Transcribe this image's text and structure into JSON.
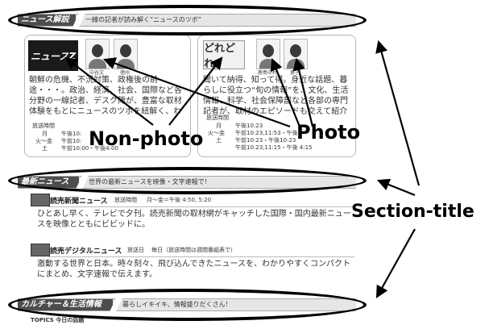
{
  "sections": {
    "news_kaisetsu": {
      "title": "ニュース解説",
      "subtitle": "一線の記者が読み解く“ニュースのツボ”"
    },
    "saishin_news": {
      "title": "最新ニュース",
      "subtitle": "世界の最新ニュースを映像・文字速報で！"
    },
    "culture": {
      "title": "カルチャー＆生活情報",
      "subtitle": "暮らしイキイキ、情報盛りだくさん！"
    }
  },
  "left_panel": {
    "logo_text": "ニュースZ",
    "person1_caption": "中谷文",
    "person2_caption": "徳州",
    "body": "朝鮮の危機、不況対策、政権後の前途・・・。政治、経済、社会、国際など各分野の一線記者、デスク陣が、豊富な取材体験をもとにニュースのツボを紐解く、わかりやすく解説します。",
    "schedule_label": "放送時間",
    "schedule": [
      {
        "day": "月",
        "time": "午後10:"
      },
      {
        "day": "火～金",
        "time": "午前10:"
      },
      {
        "day": "土",
        "time": "午前10:00・午後4:00"
      }
    ]
  },
  "right_panel": {
    "logo_text": "どれどれ",
    "person1_caption": "鹿島中村",
    "person2_caption": "恵子",
    "body": "聞いて納得、知って得。身近な話題、暮らしに役立つ“旬の情報”を、文化、生活情報、科学、社会保障部など各部の専門記者が、取材のエピソードも交えて紹介します。",
    "schedule_label": "放送時間",
    "schedule": [
      {
        "day": "月",
        "time": "午後10:23"
      },
      {
        "day": "火～金",
        "time": "午前10:23,11:53・午後"
      },
      {
        "day": "土",
        "time": "午前10:23・午後10:23"
      },
      {
        "day": "",
        "time": "午前10:23,11:15・午後 4:15"
      }
    ]
  },
  "news_items": [
    {
      "title": "読売新聞ニュース",
      "schedule_label": "放送時間",
      "schedule": "月～金＝午後 4:50, 5:20",
      "body": "ひとあし早く、テレビで夕刊。読売新聞の取材網がキャッチした国際・国内最新ニュースを映像とともにビビッドに。"
    },
    {
      "title": "読売デジタルニュース",
      "schedule_label": "放送日",
      "schedule": "毎日（放送時間は週間番組表で）",
      "body": "激動する世界と日本。時々刻々、飛び込んできたニュースを、わかりやすくコンパクトにまとめ、文字速報で伝えます。"
    }
  ],
  "bottom_fragment": "TOPICS 今日の話題",
  "annotations": {
    "non_photo": "Non-photo",
    "photo": "Photo",
    "section_title": "Section-title"
  }
}
